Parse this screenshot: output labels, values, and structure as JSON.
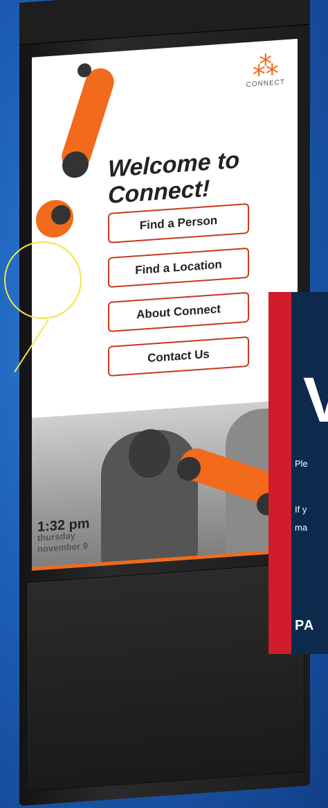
{
  "logo": {
    "wordmark": "CONNECT",
    "icon": "connect-grid-icon"
  },
  "welcome": {
    "title": "Welcome to Connect!"
  },
  "menu": [
    {
      "label": "Find a Person"
    },
    {
      "label": "Find a Location"
    },
    {
      "label": "About Connect"
    },
    {
      "label": "Contact Us"
    }
  ],
  "clock": {
    "time": "1:32 pm",
    "day": "thursday",
    "date": "november 9"
  },
  "overlay": {
    "big_letter": "V",
    "line1": "Ple",
    "line2": "If y",
    "line3": "ma",
    "brand": "PA"
  },
  "colors": {
    "accent": "#f26a1b",
    "button_border": "#c5391b",
    "overlay_bg": "#0d2a4d",
    "overlay_stripe": "#d01c2c",
    "callout": "#f1e54a"
  }
}
